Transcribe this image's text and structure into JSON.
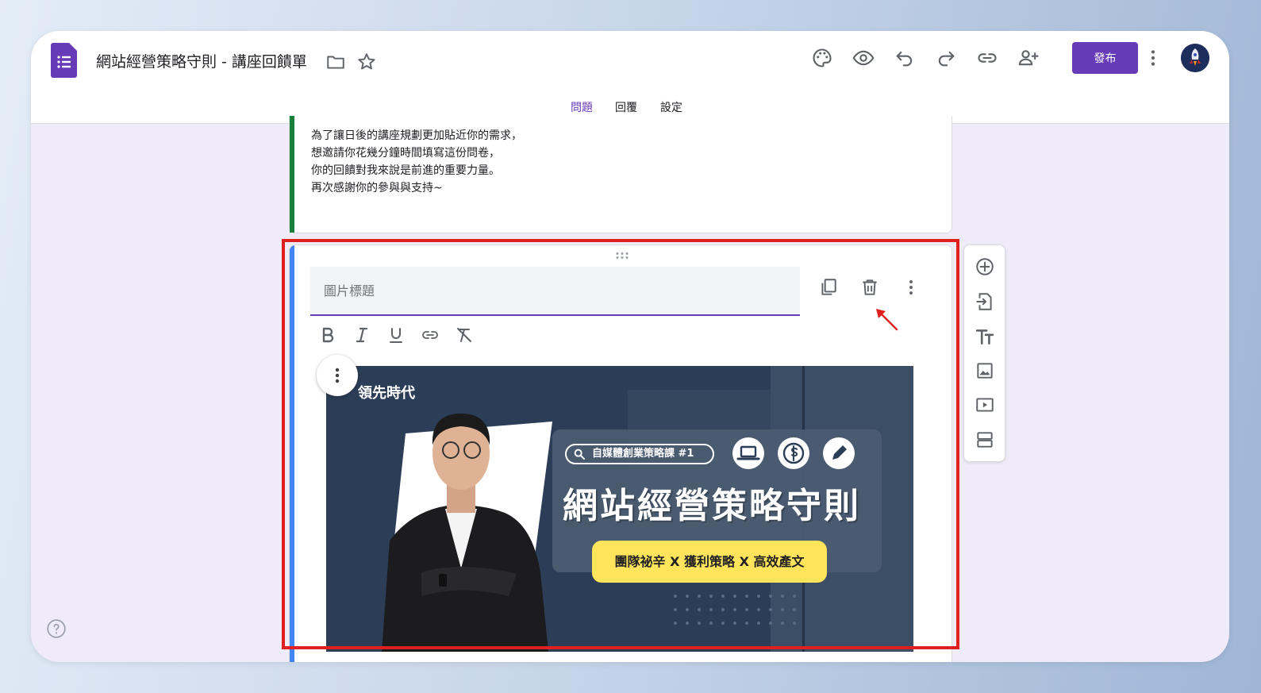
{
  "app": {
    "title": "網站經營策略守則 - 講座回饋單",
    "publish_label": "發布",
    "accent_color": "#673ab7"
  },
  "header_icons": [
    "folder-icon",
    "star-icon",
    "palette-icon",
    "preview-icon",
    "undo-icon",
    "redo-icon",
    "link-icon",
    "add-collaborator-icon",
    "more-vert-icon"
  ],
  "tabs": [
    {
      "label": "問題",
      "active": true
    },
    {
      "label": "回覆",
      "active": false
    },
    {
      "label": "設定",
      "active": false
    }
  ],
  "description": {
    "lines": [
      "為了讓日後的講座規劃更加貼近你的需求，",
      "想邀請你花幾分鐘時間填寫這份問卷，",
      "你的回饋對我來說是前進的重要力量。",
      "再次感謝你的參與與支持~"
    ]
  },
  "image_item": {
    "title_placeholder": "圖片標題",
    "title_value": "",
    "card_actions": [
      "duplicate-icon",
      "delete-icon",
      "more-vert-icon"
    ],
    "format_tools": [
      "bold-icon",
      "italic-icon",
      "underline-icon",
      "link-icon",
      "clear-format-icon"
    ]
  },
  "banner": {
    "brand": "領先時代",
    "search_tag": "自媒體創業策略課 #1",
    "title": "網站經營策略守則",
    "subtitle": "團隊祕辛 X 獲利策略 X 高效產文"
  },
  "side_toolbar": [
    "add-question-icon",
    "import-questions-icon",
    "add-title-icon",
    "add-image-icon",
    "add-video-icon",
    "add-section-icon"
  ],
  "annotation": {
    "highlight_color": "#e0201f"
  }
}
